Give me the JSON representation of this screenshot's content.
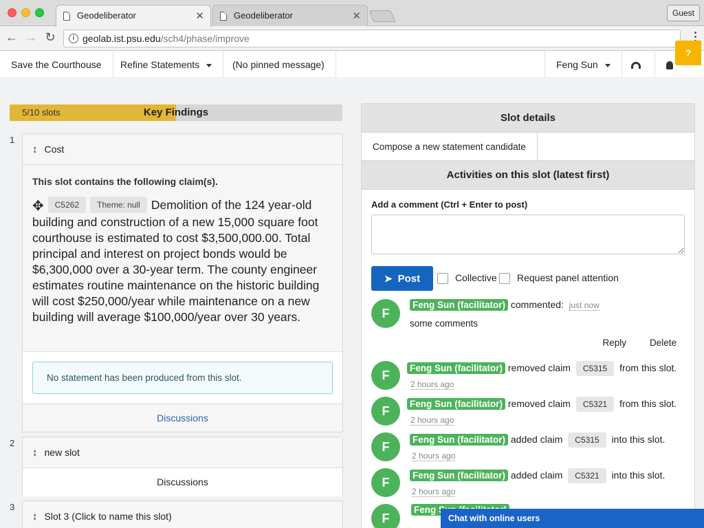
{
  "browser": {
    "tabs": [
      {
        "title": "Geodeliberator",
        "active": true
      },
      {
        "title": "Geodeliberator",
        "active": false
      }
    ],
    "close_glyph": "✕",
    "guest_label": "Guest",
    "url_host": "geolab.ist.psu.edu",
    "url_path": "/sch4/phase/improve",
    "icons": {
      "back": "arrow-left-icon",
      "forward": "arrow-right-icon",
      "reload": "reload-icon",
      "info": "info-icon"
    }
  },
  "navbar": {
    "project": "Save the Courthouse",
    "phase": "Refine Statements",
    "pinned": "(No pinned message)",
    "user": "Feng Sun"
  },
  "key_findings": {
    "count_label": "5/10 slots",
    "title": "Key Findings",
    "progress": 0.5,
    "progress_color": "#e2b636"
  },
  "slots": [
    {
      "number": "1",
      "name": "Cost",
      "intro": "This slot contains the following claim(s).",
      "claim_id": "C5262",
      "claim_theme": "Theme: null",
      "claim_text": "Demolition of the 124 year-old building and construction of a new 15,000 square foot courthouse is estimated to cost $3,500,000.00. Total principal and interest on project bonds would be $6,300,000 over a 30-year term. The county engineer estimates routine maintenance on the historic building will cost $250,000/year while maintenance on a new building will average $100,000/year over 30 years.",
      "no_statement": "No statement has been produced from this slot.",
      "discussions": "Discussions"
    },
    {
      "number": "2",
      "name": "new slot",
      "discussions": "Discussions"
    },
    {
      "number": "3",
      "name": "Slot 3 (Click to name this slot)"
    }
  ],
  "slot_details": {
    "title": "Slot details",
    "compose_tab": "Compose a new statement candidate",
    "activities_title": "Activities on this slot (latest first)",
    "comment_label": "Add a comment (Ctrl + Enter to post)",
    "post_label": "Post",
    "collective_label": "Collective",
    "panel_attention_label": "Request panel attention"
  },
  "activities": [
    {
      "avatar": "F",
      "user": "Feng Sun (facilitator)",
      "action": "commented:",
      "time": "just now",
      "body": "some comments",
      "reply": "Reply",
      "delete": "Delete"
    },
    {
      "avatar": "F",
      "user": "Feng Sun (facilitator)",
      "action": "removed claim",
      "claim": "C5315",
      "suffix": "from this slot.",
      "time": "2 hours ago"
    },
    {
      "avatar": "F",
      "user": "Feng Sun (facilitator)",
      "action": "removed claim",
      "claim": "C5321",
      "suffix": "from this slot.",
      "time": "2 hours ago"
    },
    {
      "avatar": "F",
      "user": "Feng Sun (facilitator)",
      "action": "added claim",
      "claim": "C5315",
      "suffix": "into this slot.",
      "time": "2 hours ago"
    },
    {
      "avatar": "F",
      "user": "Feng Sun (facilitator)",
      "action": "added claim",
      "claim": "C5321",
      "suffix": "into this slot.",
      "time": "2 hours ago"
    },
    {
      "avatar": "F",
      "user": "Feng Sun (facilitator)"
    }
  ],
  "help_label": "?",
  "chat_label": "Chat with online users",
  "colors": {
    "accent": "#1565c0",
    "user_badge": "#4cb35a",
    "help": "#f7b500"
  }
}
